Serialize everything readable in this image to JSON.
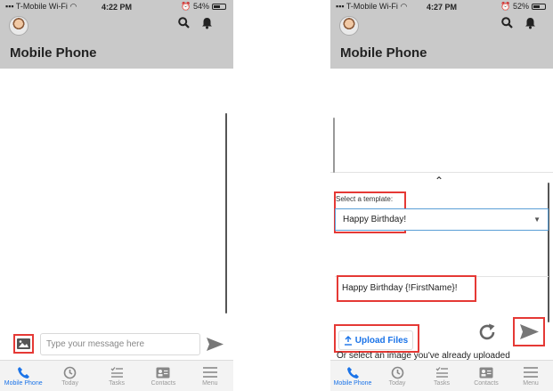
{
  "left_screen": {
    "status": {
      "carrier": "T-Mobile Wi-Fi",
      "time": "4:22 PM",
      "battery": "54%"
    },
    "header": {
      "title": "Mobile Phone"
    },
    "composer": {
      "placeholder": "Type your message here"
    }
  },
  "right_screen": {
    "status": {
      "carrier": "T-Mobile Wi-Fi",
      "time": "4:27 PM",
      "battery": "52%"
    },
    "header": {
      "title": "Mobile Phone"
    },
    "template": {
      "label": "Select a template:",
      "selected": "Happy Birthday!",
      "preview_text": "Happy Birthday {!FirstName}!"
    },
    "upload_label": "Upload Files",
    "select_existing_text": "Or select an image you've already uploaded"
  },
  "tabs": [
    {
      "label": "Mobile Phone",
      "icon": "phone-icon",
      "active": true
    },
    {
      "label": "Today",
      "icon": "clock-icon",
      "active": false
    },
    {
      "label": "Tasks",
      "icon": "tasks-icon",
      "active": false
    },
    {
      "label": "Contacts",
      "icon": "contacts-icon",
      "active": false
    },
    {
      "label": "Menu",
      "icon": "menu-icon",
      "active": false
    }
  ],
  "colors": {
    "header_bg": "#c9c9c9",
    "accent_blue": "#1a73e8",
    "highlight_red": "#e53935"
  }
}
